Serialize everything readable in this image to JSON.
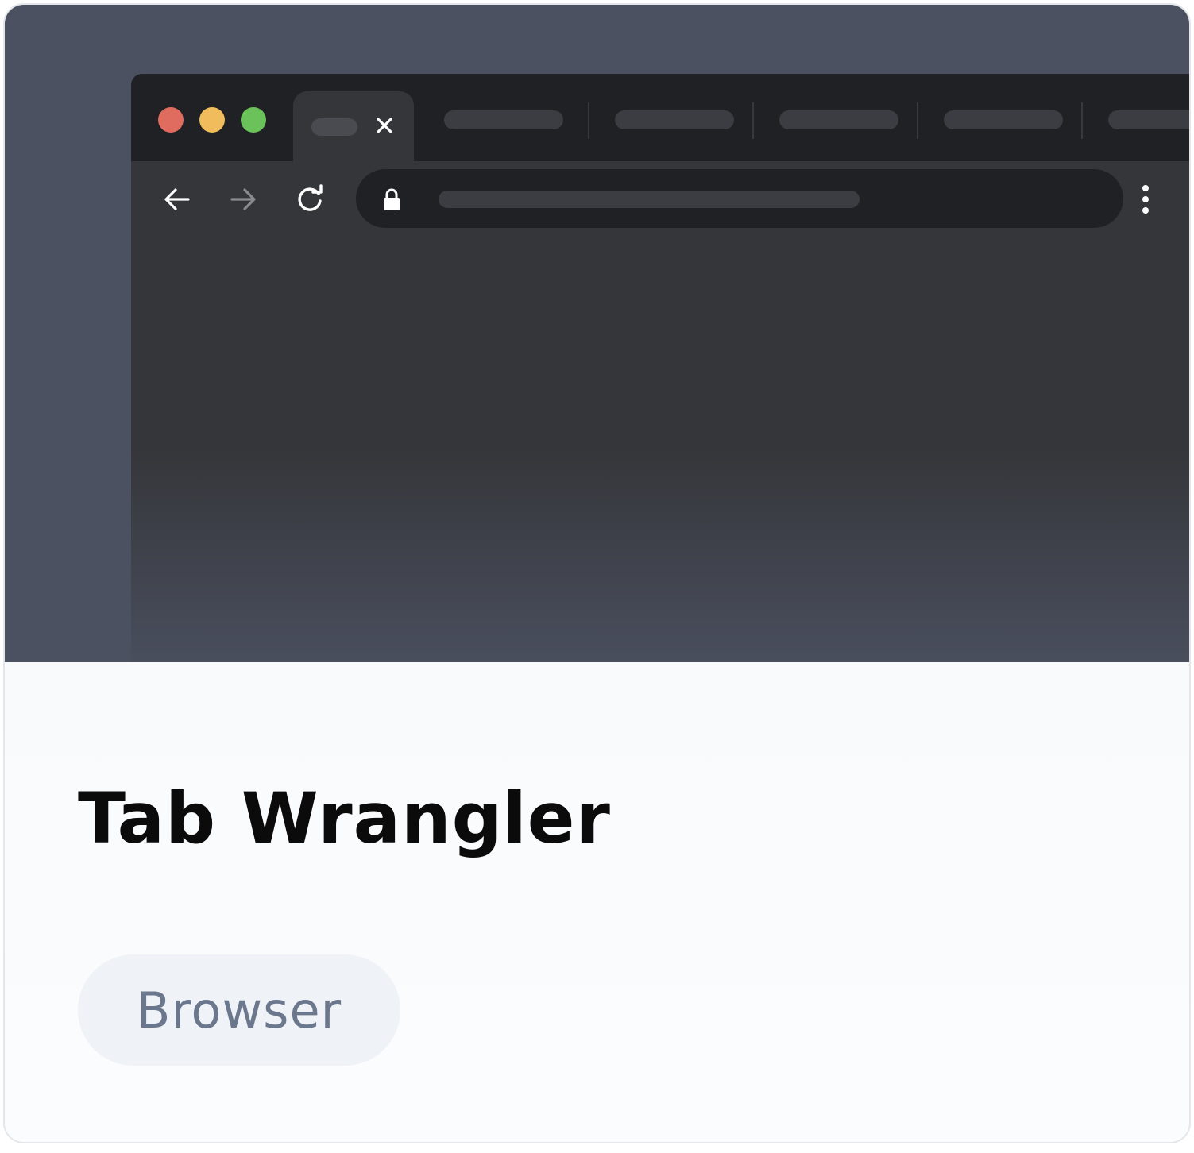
{
  "card": {
    "title": "Tab Wrangler",
    "category_badge": "Browser"
  },
  "browser_mockup": {
    "window_controls": [
      {
        "name": "close",
        "color": "#e06c60"
      },
      {
        "name": "minimize",
        "color": "#f1bd5c"
      },
      {
        "name": "maximize",
        "color": "#6bc25a"
      }
    ],
    "active_tab": {
      "close_icon": "close-icon"
    },
    "toolbar_icons": [
      "back-arrow-icon",
      "forward-arrow-icon",
      "reload-icon",
      "lock-icon",
      "more-vert-icon"
    ]
  },
  "colors": {
    "hero_background": "#4b5160",
    "tabstrip": "#202124",
    "toolbar": "#35363a",
    "title_text": "#0b0b0c",
    "badge_background": "#eff2f6",
    "badge_text": "#6b778c"
  }
}
